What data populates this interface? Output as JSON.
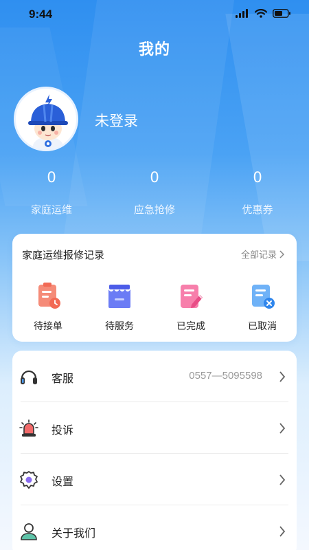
{
  "status_bar": {
    "time": "9:44"
  },
  "header": {
    "title": "我的"
  },
  "profile": {
    "username": "未登录"
  },
  "stats": [
    {
      "value": "0",
      "label": "家庭运维"
    },
    {
      "value": "0",
      "label": "应急抢修"
    },
    {
      "value": "0",
      "label": "优惠券"
    }
  ],
  "records": {
    "title": "家庭运维报修记录",
    "all_label": "全部记录",
    "items": [
      {
        "label": "待接单",
        "icon": "clipboard-clock-icon"
      },
      {
        "label": "待服务",
        "icon": "store-icon"
      },
      {
        "label": "已完成",
        "icon": "edit-document-icon"
      },
      {
        "label": "已取消",
        "icon": "cancelled-document-icon"
      }
    ]
  },
  "menu": [
    {
      "label": "客服",
      "value": "0557—5095598",
      "icon": "headset-icon"
    },
    {
      "label": "投诉",
      "value": "",
      "icon": "alarm-siren-icon"
    },
    {
      "label": "设置",
      "value": "",
      "icon": "gear-icon"
    },
    {
      "label": "关于我们",
      "value": "",
      "icon": "user-icon"
    }
  ],
  "colors": {
    "header_blue": "#2f8ff0",
    "pending_icon": "#f07a6a",
    "service_icon": "#5b6ef0",
    "done_icon": "#f26aa0",
    "cancel_icon": "#4a9cf5"
  }
}
